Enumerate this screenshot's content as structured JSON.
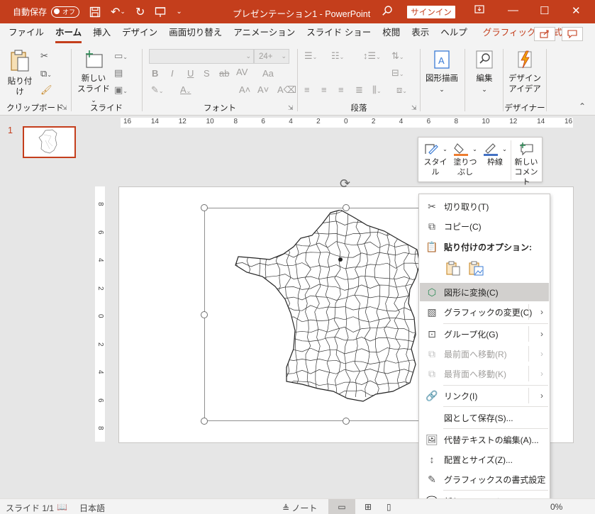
{
  "titlebar": {
    "autosave_label": "自動保存",
    "autosave_state": "オフ",
    "doc_title": "プレゼンテーション1  -  PowerPoint",
    "signin": "サインイン",
    "bg_color": "#c43e1c"
  },
  "tabs": [
    {
      "label": "ファイル"
    },
    {
      "label": "ホーム"
    },
    {
      "label": "挿入"
    },
    {
      "label": "デザイン"
    },
    {
      "label": "画面切り替え"
    },
    {
      "label": "アニメーション"
    },
    {
      "label": "スライド ショー"
    },
    {
      "label": "校閲"
    },
    {
      "label": "表示"
    },
    {
      "label": "ヘルプ"
    },
    {
      "label": "グラフィックス形式"
    }
  ],
  "ribbon": {
    "clipboard": {
      "paste": "貼り付け",
      "group": "クリップボード"
    },
    "slides": {
      "new_slide": "新しい\nスライド",
      "new_slide_l1": "新しい",
      "new_slide_l2": "スライド",
      "group": "スライド"
    },
    "font": {
      "font_size": "24+",
      "group": "フォント",
      "bold": "B",
      "italic": "I",
      "underline": "U",
      "shadow": "S",
      "strike": "ab",
      "spacing": "AV",
      "case": "Aa"
    },
    "paragraph": {
      "group": "段落"
    },
    "drawing": {
      "shapes_label": "図形描画"
    },
    "editing": {
      "label": "編集"
    },
    "designer": {
      "l1": "デザイン",
      "l2": "アイデア",
      "group": "デザイナー"
    }
  },
  "thumbnails": {
    "number": "1"
  },
  "rulers": {
    "horizontal": [
      "16",
      "14",
      "12",
      "10",
      "8",
      "6",
      "4",
      "2",
      "0",
      "2",
      "4",
      "6",
      "8",
      "10",
      "12",
      "14",
      "16"
    ],
    "vertical": [
      "8",
      "6",
      "4",
      "2",
      "0",
      "2",
      "4",
      "6",
      "8"
    ]
  },
  "minibar": {
    "style": "スタイル",
    "fill_l1": "塗りつ",
    "fill_l2": "ぶし",
    "outline": "枠線",
    "comment_l1": "新しい",
    "comment_l2": "コメント"
  },
  "context_menu": {
    "cut": "切り取り(T)",
    "copy": "コピー(C)",
    "paste_options": "貼り付けのオプション:",
    "convert_to_shape": "図形に変換(C)",
    "change_graphic": "グラフィックの変更(C)",
    "group": "グループ化(G)",
    "bring_front": "最前面へ移動(R)",
    "send_back": "最背面へ移動(K)",
    "link": "リンク(I)",
    "save_as_picture": "図として保存(S)...",
    "alt_text": "代替テキストの編集(A)...",
    "size_position": "配置とサイズ(Z)...",
    "format_graphic": "グラフィックスの書式設定",
    "new_comment": "新しいコメント(M)"
  },
  "statusbar": {
    "slide": "スライド 1/1",
    "language": "日本語",
    "notes": "ノート",
    "zoom": "0%"
  }
}
